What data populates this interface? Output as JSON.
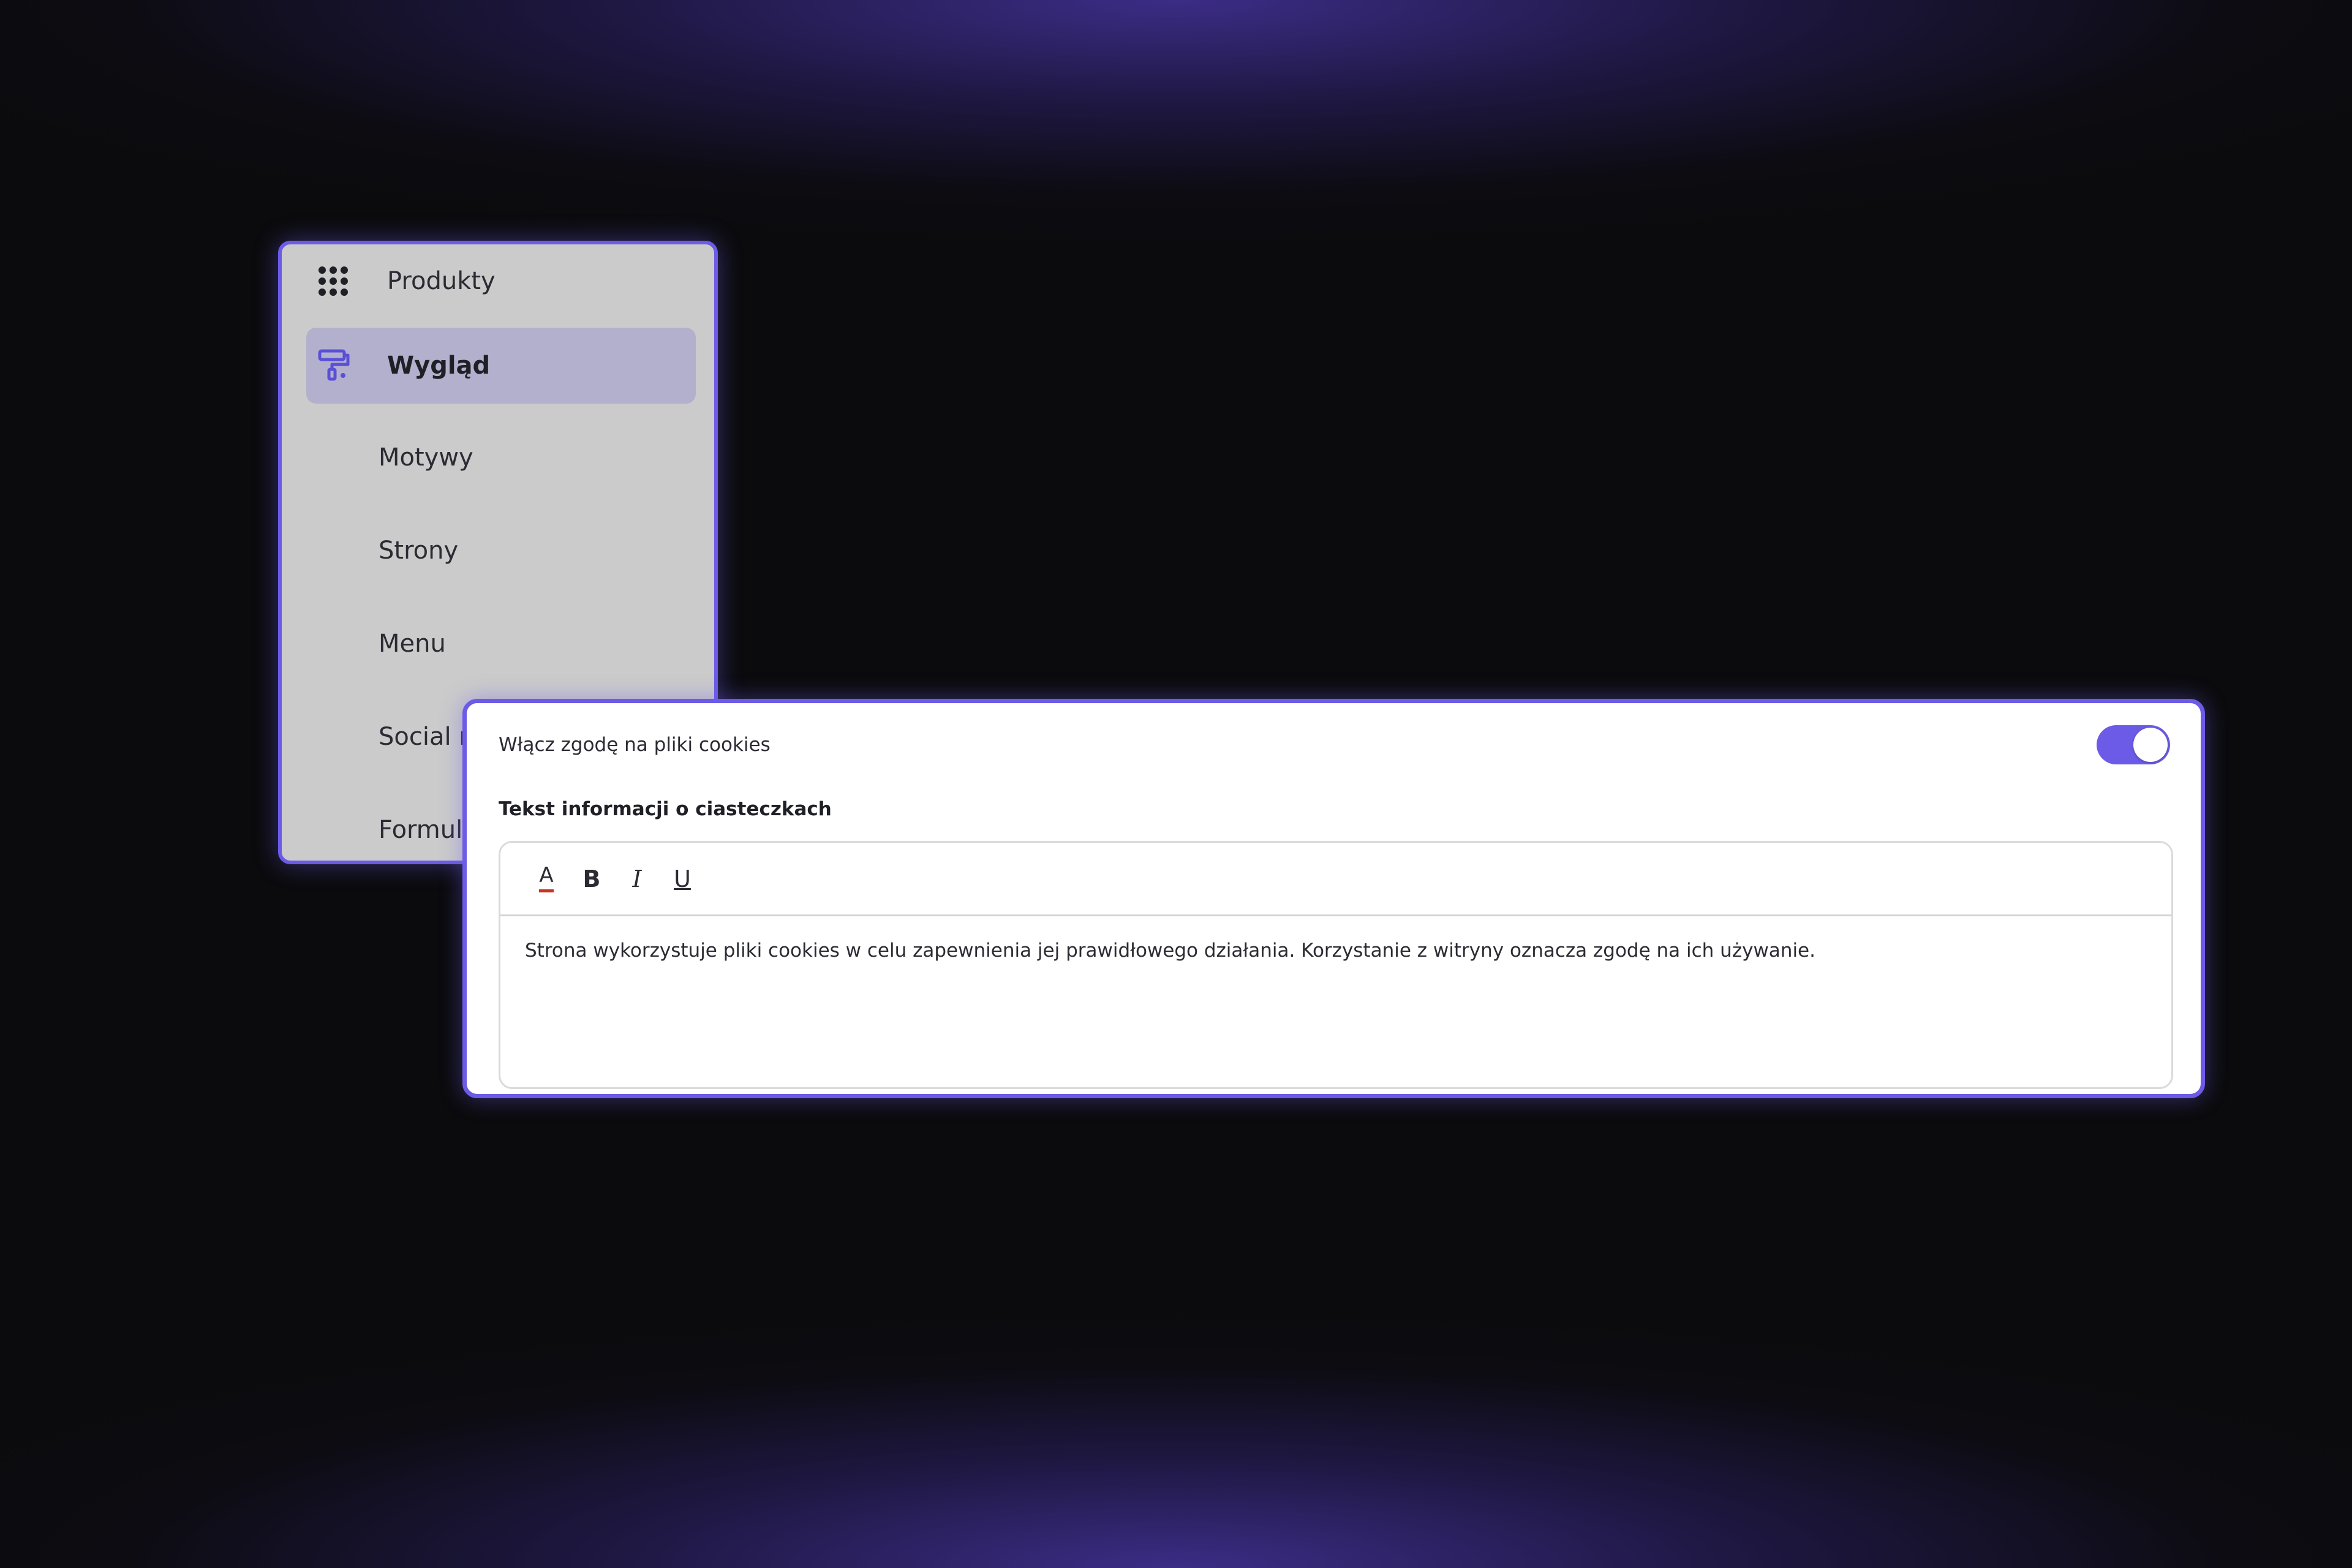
{
  "colors": {
    "accent": "#6b5be6",
    "sidebar_bg": "#cbcbcb",
    "sidebar_active_bg": "#b3b0ce",
    "text_color_underline": "#c7331f"
  },
  "sidebar": {
    "items": [
      {
        "label": "Produkty",
        "icon": "grid-dots-icon",
        "active": false
      },
      {
        "label": "Wygląd",
        "icon": "paint-roller-icon",
        "active": true
      },
      {
        "label": "Motywy",
        "sub": true
      },
      {
        "label": "Strony",
        "sub": true
      },
      {
        "label": "Menu",
        "sub": true
      },
      {
        "label": "Social media",
        "sub": true
      },
      {
        "label": "Formularze",
        "sub": true
      }
    ]
  },
  "cookies": {
    "toggle_label": "Włącz zgodę na pliki cookies",
    "toggle_on": true,
    "section_label": "Tekst informacji o ciasteczkach",
    "toolbar": {
      "text_color": "A",
      "bold": "B",
      "italic": "I",
      "underline": "U"
    },
    "body_text": "Strona wykorzystuje pliki cookies w celu zapewnienia jej prawidłowego działania. Korzystanie z witryny oznacza zgodę na ich używanie."
  }
}
